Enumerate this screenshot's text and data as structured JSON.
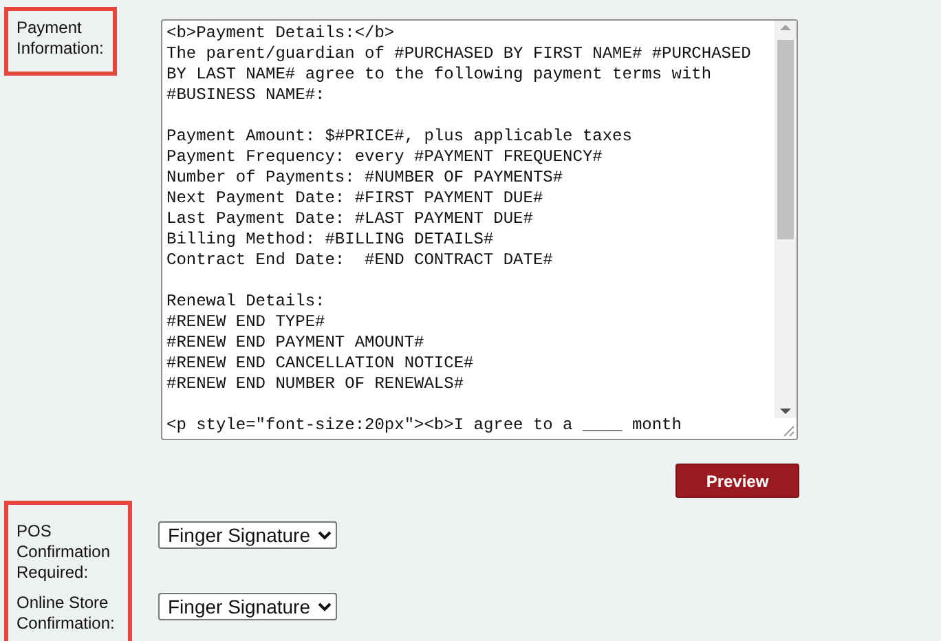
{
  "payment_information": {
    "label": "Payment Information:",
    "template_text": "<b>Payment Details:</b>\nThe parent/guardian of #PURCHASED BY FIRST NAME# #PURCHASED BY LAST NAME# agree to the following payment terms with #BUSINESS NAME#:\n\nPayment Amount: $#PRICE#, plus applicable taxes\nPayment Frequency: every #PAYMENT FREQUENCY#\nNumber of Payments: #NUMBER OF PAYMENTS#\nNext Payment Date: #FIRST PAYMENT DUE#\nLast Payment Date: #LAST PAYMENT DUE#\nBilling Method: #BILLING DETAILS#\nContract End Date:  #END CONTRACT DATE#\n\nRenewal Details:\n#RENEW END TYPE#\n#RENEW END PAYMENT AMOUNT#\n#RENEW END CANCELLATION NOTICE#\n#RENEW END NUMBER OF RENEWALS#\n\n<p style=\"font-size:20px\"><b>I agree to a ____ month"
  },
  "preview_button": "Preview",
  "confirmations": [
    {
      "label": "POS Confirmation Required:",
      "value": "Finger Signature"
    },
    {
      "label": "Online Store Confirmation:",
      "value": "Finger Signature"
    }
  ]
}
